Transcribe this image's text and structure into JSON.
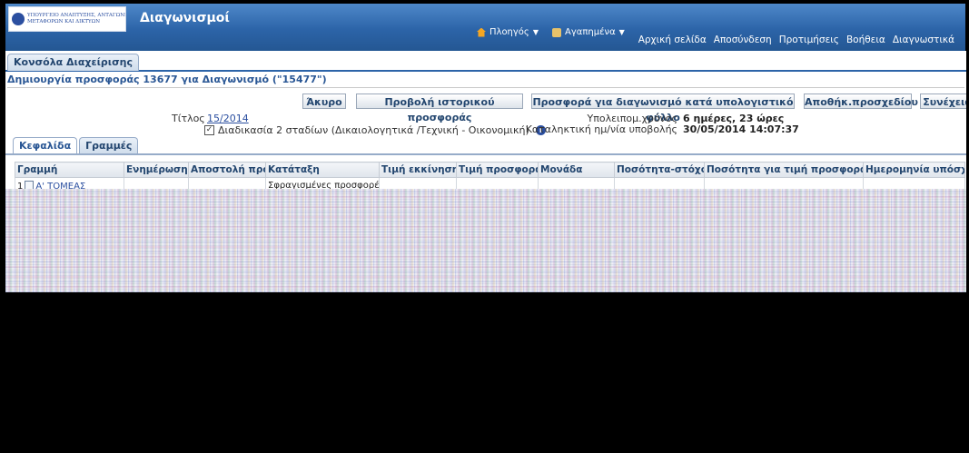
{
  "brand": {
    "logo_lines": [
      "ΥΠΟΥΡΓΕΙΟ ΑΝΑΠΤΥΞΗΣ, ΑΝΤΑΓΩΝΙΣΤΙΚΟΤΗΤΑΣ, ΥΠΟΔΟΜΩΝ,",
      "ΜΕΤΑΦΟΡΩΝ ΚΑΙ ΔΙΚΤΥΩΝ"
    ],
    "app_title": "Διαγωνισμοί"
  },
  "global_nav": {
    "navigator": "Πλοηγός",
    "favorites": "Αγαπημένα",
    "links": [
      "Αρχική σελίδα",
      "Αποσύνδεση",
      "Προτιμήσεις",
      "Βοήθεια",
      "Διαγνωστικά"
    ]
  },
  "main_tab": "Κονσόλα Διαχείρισης",
  "page_heading": "Δημιουργία προσφοράς 13677 για Διαγωνισμό (\"15477\")",
  "buttons": {
    "cancel": "Άκυρο",
    "history": "Προβολή ιστορικού προσφοράς",
    "spreadsheet": "Προσφορά για διαγωνισμό κατά υπολογιστικό φύλλο",
    "save_draft": "Αποθήκ.προσχεδίου",
    "continue": "Συνέχεια"
  },
  "details": {
    "title_label": "Τίτλος",
    "title_value": "15/2014",
    "two_stage_label": "Διαδικασία 2 σταδίων (Δικαιολογητικά /Τεχνική - Οικονομική)",
    "remaining_label": "Υπολειπομ.χρόνος",
    "remaining_value": "6 ημέρες, 23 ώρες",
    "deadline_label": "Καταληκτική ημ/νία υποβολής",
    "deadline_value": "30/05/2014 14:07:37"
  },
  "sub_tabs": [
    "Κεφαλίδα",
    "Γραμμές"
  ],
  "grid": {
    "headers": [
      "Γραμμή",
      "Ενημέρωση",
      "Αποστολή προς",
      "Κατάταξη",
      "Τιμή εκκίνησης",
      "Τιμή προσφοράς",
      "Μονάδα",
      "Ποσότητα-στόχος",
      "Ποσότητα για τιμή προσφοράς",
      "Ημερομηνία υπόσχεσης"
    ],
    "rows": [
      {
        "num": "1",
        "line": "Α' ΤΟΜΕΑΣ",
        "update": "",
        "ship_to": "",
        "rank": "Σφραγισμένες προσφορές",
        "start_price": "",
        "bid_price": "",
        "unit": "",
        "target_qty": "",
        "bid_qty": "",
        "promise_date": ""
      }
    ]
  },
  "colors": {
    "banner": "#2c64a8",
    "link": "#2b4fa0",
    "header_text": "#23466f"
  }
}
